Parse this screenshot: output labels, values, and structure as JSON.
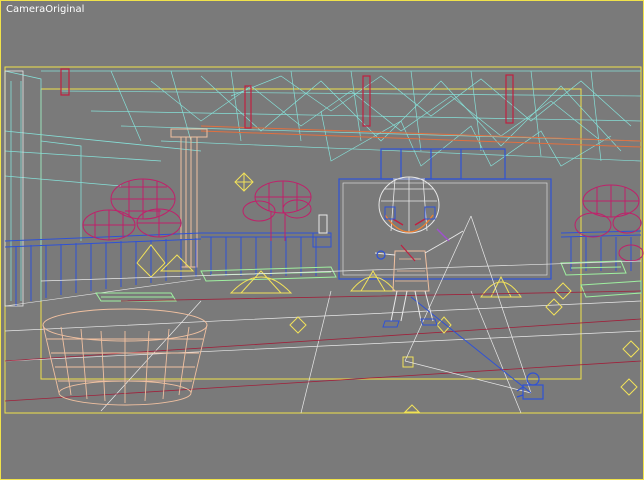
{
  "viewport": {
    "camera_name": "CameraOriginal",
    "colors": {
      "background": "#7a7a7a",
      "safe_frame": "#f0e24a",
      "wire_cyan": "#86e0d8",
      "wire_green": "#9ff0a0",
      "wire_blue": "#2f52d6",
      "wire_red": "#a0203a",
      "wire_magenta": "#c0206a",
      "wire_orange": "#f0c0a0",
      "wire_yellow": "#f2e25a",
      "wire_white": "#e8e8e8"
    }
  }
}
